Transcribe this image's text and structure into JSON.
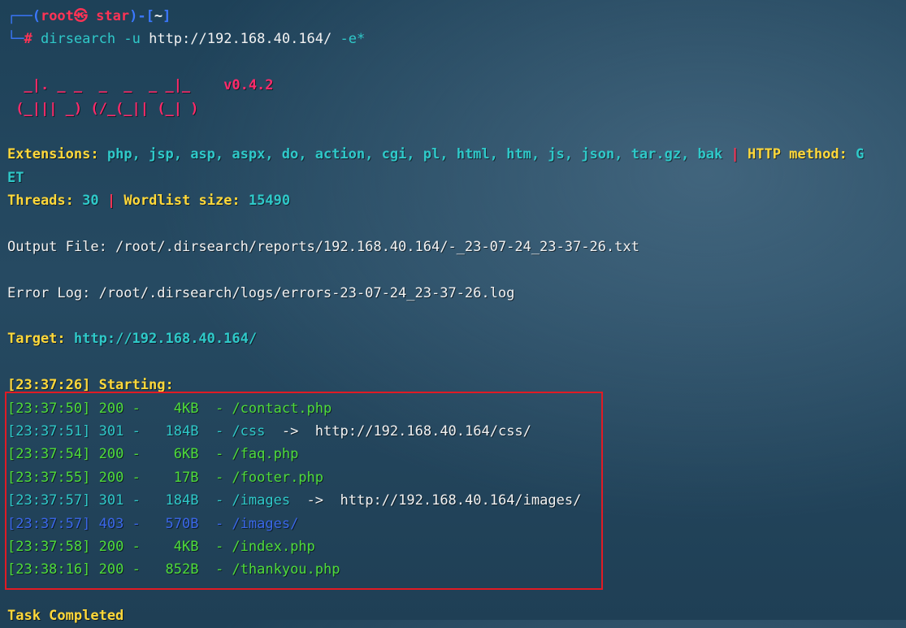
{
  "prompt": {
    "line1_prefix": "┌──(",
    "user": "root",
    "at_symbol": "㉿",
    "host": "star",
    "mid": ")-[",
    "dir": "~",
    "end": "]",
    "line2_prefix": "└─",
    "hash": "#",
    "command": "dirsearch",
    "arg_flag_u": "-u",
    "arg_url": "http://192.168.40.164/",
    "arg_flag_e": "-e*"
  },
  "banner": {
    "logo_line1": "  _|. _ _  _  _  _ _|_    ",
    "logo_line2": " (_||| _) (/_(_|| (_| )   ",
    "version": "v0.4.2"
  },
  "config": {
    "extensions_label": "Extensions:",
    "extensions_value": "php, jsp, asp, aspx, do, action, cgi, pl, html, htm, js, json, tar.gz, bak",
    "separator": "|",
    "http_method_label": "HTTP method:",
    "http_method_value_part1": "G",
    "http_method_value_part2": "ET",
    "threads_label": "Threads:",
    "threads_value": "30",
    "wordlist_label": "Wordlist size:",
    "wordlist_value": "15490"
  },
  "output_file": "Output File: /root/.dirsearch/reports/192.168.40.164/-_23-07-24_23-37-26.txt",
  "error_log": "Error Log: /root/.dirsearch/logs/errors-23-07-24_23-37-26.log",
  "target": {
    "label": "Target:",
    "value": "http://192.168.40.164/"
  },
  "starting": "[23:37:26] Starting:",
  "results": [
    {
      "time": "[23:37:50]",
      "status": "200",
      "size": "  4KB",
      "path": "/contact.php",
      "redirect": "",
      "color": "#4fdc3a"
    },
    {
      "time": "[23:37:51]",
      "status": "301",
      "size": " 184B",
      "path": "/css",
      "redirect": "http://192.168.40.164/css/",
      "color": "#2fc9c9"
    },
    {
      "time": "[23:37:54]",
      "status": "200",
      "size": "  6KB",
      "path": "/faq.php",
      "redirect": "",
      "color": "#4fdc3a"
    },
    {
      "time": "[23:37:55]",
      "status": "200",
      "size": "  17B",
      "path": "/footer.php",
      "redirect": "",
      "color": "#4fdc3a"
    },
    {
      "time": "[23:37:57]",
      "status": "301",
      "size": " 184B",
      "path": "/images",
      "redirect": "http://192.168.40.164/images/",
      "color": "#2fc9c9"
    },
    {
      "time": "[23:37:57]",
      "status": "403",
      "size": " 570B",
      "path": "/images/",
      "redirect": "",
      "color": "#3a67e8"
    },
    {
      "time": "[23:37:58]",
      "status": "200",
      "size": "  4KB",
      "path": "/index.php",
      "redirect": "",
      "color": "#4fdc3a"
    },
    {
      "time": "[23:38:16]",
      "status": "200",
      "size": " 852B",
      "path": "/thankyou.php",
      "redirect": "",
      "color": "#4fdc3a"
    }
  ],
  "task_completed": "Task Completed",
  "colors": {
    "highlight_box": "#e01b24",
    "prompt_blue": "#3b78ff",
    "prompt_red": "#ff3355",
    "label_yellow": "#ffd83a",
    "value_cyan": "#2fc9c9",
    "logo_pink": "#ff2a6a"
  }
}
